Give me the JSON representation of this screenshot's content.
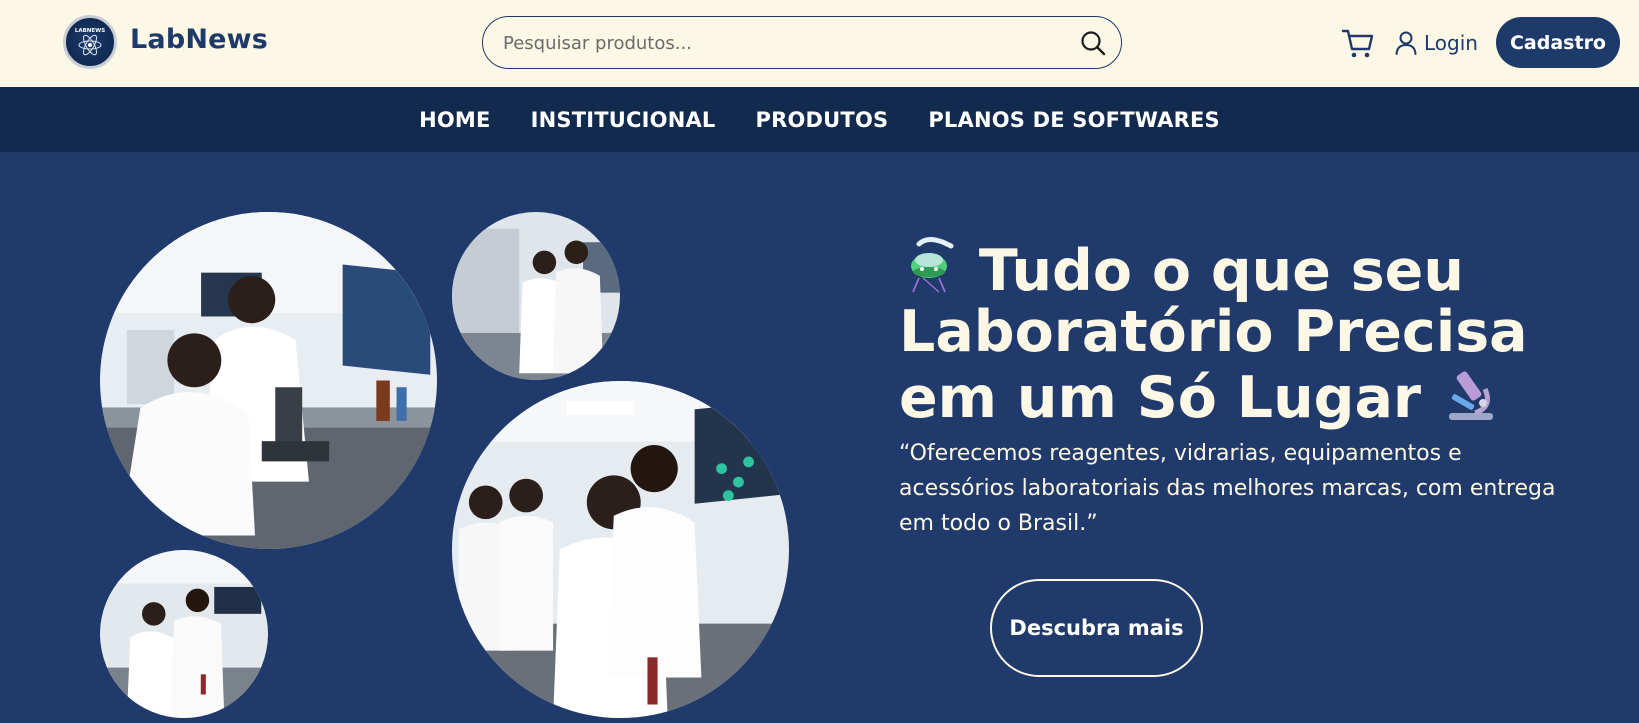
{
  "header": {
    "logo_text": "LABNEWS",
    "brand": "LabNews",
    "search": {
      "placeholder": "Pesquisar produtos..."
    },
    "login_label": "Login",
    "signup_label": "Cadastro"
  },
  "nav": {
    "items": [
      {
        "label": "HOME"
      },
      {
        "label": "INSTITUCIONAL"
      },
      {
        "label": "PRODUTOS"
      },
      {
        "label": "PLANOS DE SOFTWARES"
      }
    ]
  },
  "hero": {
    "title_lead_icon": "ufo-icon",
    "title_line": "Tudo o que seu Laboratório Precisa em um Só Lugar",
    "title_trail_icon": "microscope-icon",
    "subtitle": "“Oferecemos reagentes, vidrarias, equipamentos e acessórios laboratoriais das melhores marcas, com entrega em todo o Brasil.”",
    "cta_label": "Descubra mais"
  },
  "colors": {
    "header_bg": "#fdf8e6",
    "nav_bg": "#132a4f",
    "hero_bg": "#1f3a6b",
    "brand": "#1e3a6a"
  }
}
